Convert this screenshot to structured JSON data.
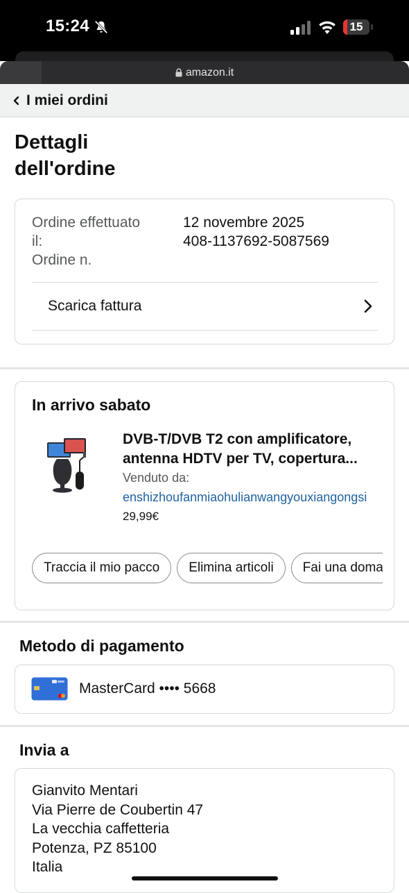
{
  "status_bar": {
    "time": "15:24",
    "battery_level": "15",
    "battery_color": "#e5372f"
  },
  "browser": {
    "url": "amazon.it"
  },
  "nav": {
    "back_label": "I miei ordini"
  },
  "page": {
    "title_line1": "Dettagli",
    "title_line2": "dell'ordine"
  },
  "order_info": {
    "placed_label_line1": "Ordine effettuato",
    "placed_label_line2": "il:",
    "number_label": "Ordine n.",
    "placed_date": "12 novembre 2025",
    "order_number": "408-1137692-5087569",
    "invoice_label": "Scarica fattura"
  },
  "shipment": {
    "heading": "In arrivo sabato",
    "product_title_line1": "DVB-T/DVB T2 con amplificatore,",
    "product_title_line2": "antenna HDTV per TV, copertura...",
    "sold_by_label": "Venduto da:",
    "seller": "enshizhoufanmiaohulianwangyouxiangongsi",
    "price": "29,99€",
    "actions": [
      "Traccia il mio pacco",
      "Elimina articoli",
      "Fai una domanda"
    ]
  },
  "payment": {
    "heading": "Metodo di pagamento",
    "card_text": "MasterCard •••• 5668",
    "card_color": "#2f6fd6"
  },
  "shipping": {
    "heading": "Invia a",
    "address_lines": [
      "Gianvito Mentari",
      "Via Pierre de Coubertin 47",
      "La vecchia caffetteria",
      "Potenza, PZ 85100",
      "Italia"
    ]
  },
  "colors": {
    "link": "#2162a1",
    "nav_background": "#f0f2f2",
    "border": "#d5d9d9"
  }
}
